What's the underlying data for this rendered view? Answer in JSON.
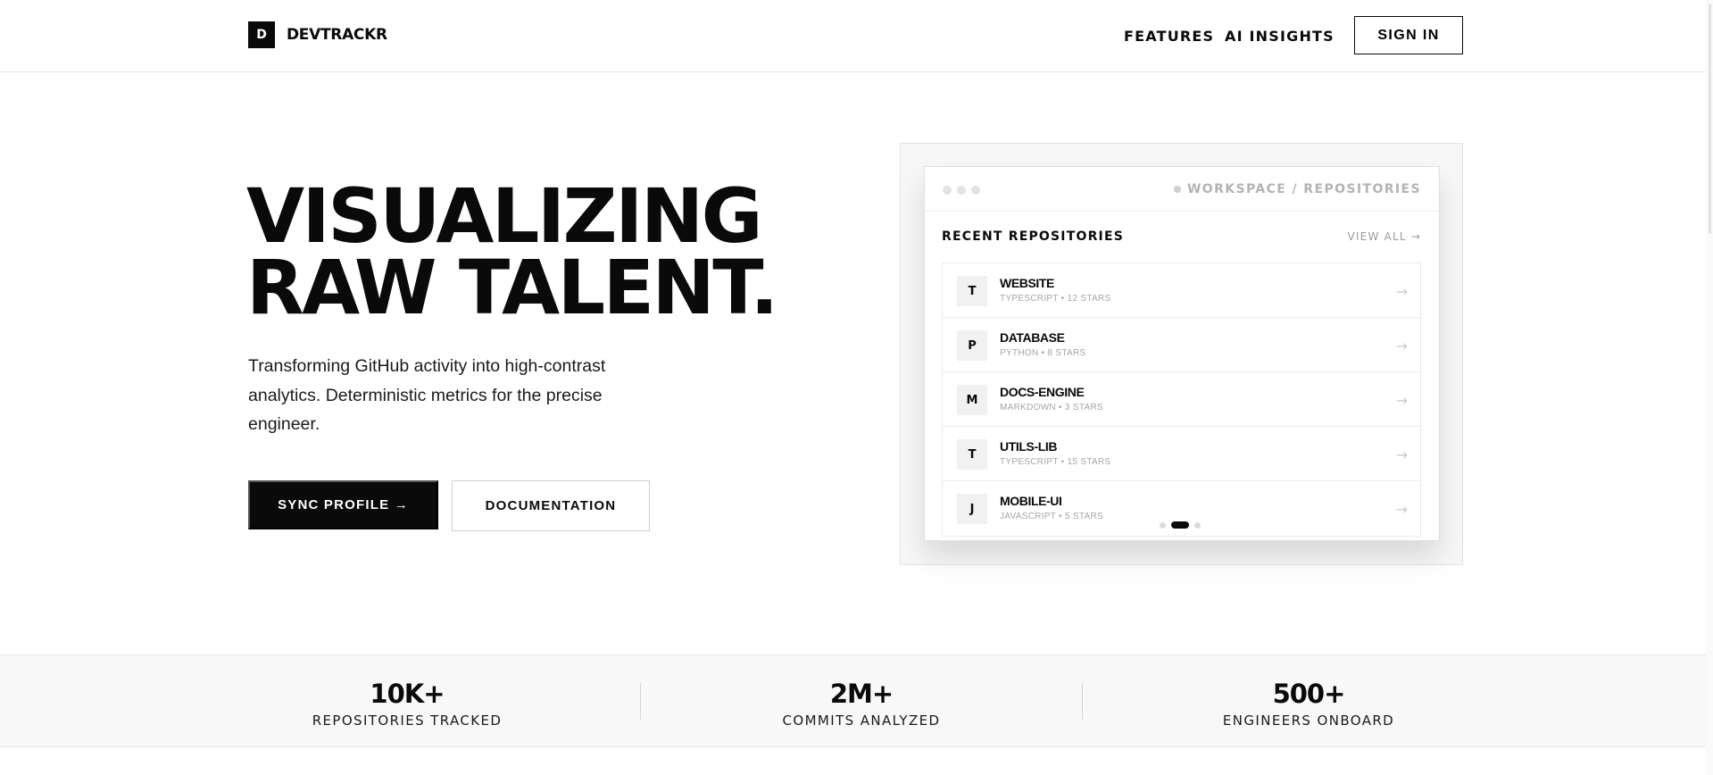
{
  "nav": {
    "logo_mark": "D",
    "brand": "DEVTRACKR",
    "links": [
      "FEATURES",
      "AI INSIGHTS"
    ],
    "signin_label": "SIGN IN"
  },
  "hero": {
    "headline_line1": "VISUALIZING",
    "headline_line2": "RAW TALENT.",
    "subtext": "Transforming GitHub activity into high-contrast analytics. Deterministic metrics for the precise engineer.",
    "primary_cta": "SYNC PROFILE →",
    "secondary_cta": "DOCUMENTATION"
  },
  "preview": {
    "breadcrumb": "WORKSPACE / REPOSITORIES",
    "section_title": "RECENT REPOSITORIES",
    "view_all": "VIEW ALL →",
    "repos": [
      {
        "initial": "T",
        "name": "WEBSITE",
        "meta": "TYPESCRIPT • 12 STARS"
      },
      {
        "initial": "P",
        "name": "DATABASE",
        "meta": "PYTHON • 8 STARS"
      },
      {
        "initial": "M",
        "name": "DOCS-ENGINE",
        "meta": "MARKDOWN • 3 STARS"
      },
      {
        "initial": "T",
        "name": "UTILS-LIB",
        "meta": "TYPESCRIPT • 15 STARS"
      },
      {
        "initial": "J",
        "name": "MOBILE-UI",
        "meta": "JAVASCRIPT • 5 STARS"
      }
    ],
    "arrow": "→",
    "pager": {
      "count": 3,
      "active": 2
    }
  },
  "stats": [
    {
      "value": "10K+",
      "label": "REPOSITORIES TRACKED"
    },
    {
      "value": "2M+",
      "label": "COMMITS ANALYZED"
    },
    {
      "value": "500+",
      "label": "ENGINEERS ONBOARD"
    }
  ],
  "colors": {
    "ink": "#0a0a0a",
    "muted": "#a5a5a5",
    "panel": "#f7f7f7"
  }
}
